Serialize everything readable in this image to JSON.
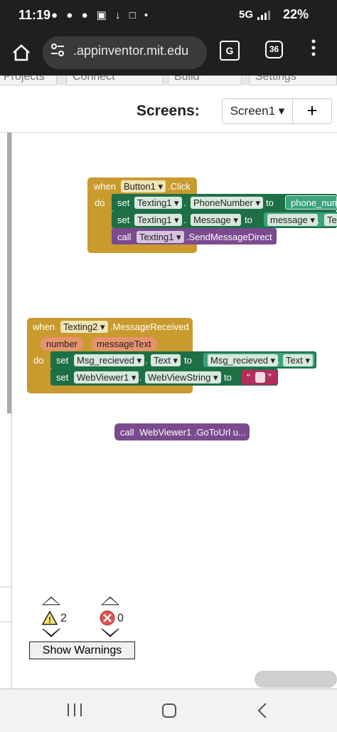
{
  "status_bar": {
    "time": "11:19",
    "notification_icons": "● ● ● ▣ ↓ □ •",
    "signal": "5G",
    "battery": "22%"
  },
  "browser": {
    "url": ".appinventor.mit.edu",
    "tab_count": "36",
    "translate_glyph": "G"
  },
  "toolbar_tabs": [
    "Projects",
    "Connect",
    "Build",
    "Settings"
  ],
  "screens": {
    "label": "Screens:",
    "selected": "Screen1 ▾",
    "add": "+"
  },
  "blocks": {
    "event1": {
      "when": "when",
      "component": "Button1",
      "event": ".Click",
      "do": "do",
      "stmt1": {
        "set": "set",
        "comp": "Texting1",
        "dot": ".",
        "prop": "PhoneNumber",
        "to": "to",
        "value": "phone_num"
      },
      "stmt2": {
        "set": "set",
        "comp": "Texting1",
        "dot": ".",
        "prop": "Message",
        "to": "to",
        "value": "message",
        "dot2": ".",
        "value2": "Te"
      },
      "stmt3": {
        "call": "call",
        "comp": "Texting1",
        "method": ".SendMessageDirect"
      }
    },
    "event2": {
      "when": "when",
      "component": "Texting2",
      "event": ".MessageReceived",
      "param1": "number",
      "param2": "messageText",
      "do": "do",
      "stmt1": {
        "set": "set",
        "comp": "Msg_recieved",
        "dot": ".",
        "prop": "Text",
        "to": "to",
        "comp2": "Msg_recieved",
        "dot2": ".",
        "prop2": "Text"
      },
      "stmt2": {
        "set": "set",
        "comp": "WebViewer1",
        "dot": ".",
        "prop": "WebViewString",
        "to": "to",
        "open_quote": "“",
        "close_quote": "”"
      }
    },
    "loose_call": {
      "call": "call",
      "text": "WebViewer1 .GoToUrl u..."
    }
  },
  "warnings": {
    "warning_count": "2",
    "error_count": "0",
    "show_warnings": "Show Warnings"
  },
  "colors": {
    "event": "#c99a2e",
    "set": "#1e6f45",
    "call": "#7b4a8f",
    "text": "#b32d5e"
  }
}
